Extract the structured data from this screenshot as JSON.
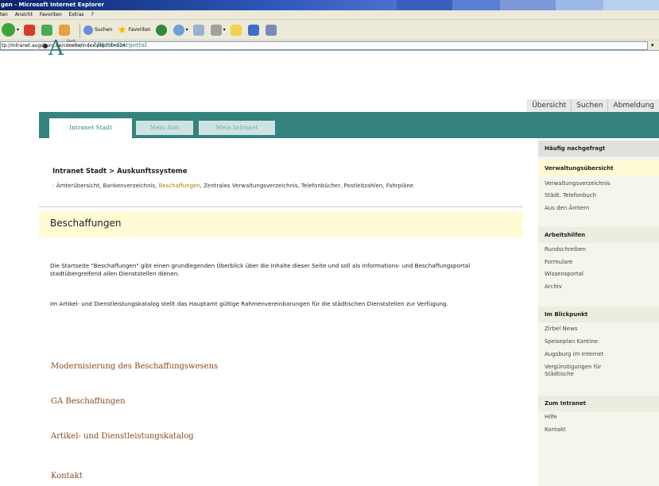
{
  "window": {
    "title": "gen - Microsoft Internet Explorer",
    "menu": [
      "ten",
      "Ansicht",
      "Favoriten",
      "Extras",
      "?"
    ],
    "toolbar": {
      "search_label": "Suchen",
      "favorites_label": "Favoriten"
    },
    "address": "tp://intranet.augsburg.de/cocoite/index.php?id=924"
  },
  "header": {
    "logo_small": "Stadt Augsburg",
    "portal_name": "Mitarbeiterportal",
    "topnav": [
      "Übersicht",
      "Suchen",
      "Abmeldung"
    ]
  },
  "tabs": [
    "Intranet Stadt",
    "Mein Amt",
    "Mein Intranet"
  ],
  "breadcrumb": "Intranet Stadt > Auskunftssysteme",
  "subnav": {
    "before": "Ämterübersicht, Bankenverzeichnis, ",
    "current": "Beschaffungen",
    "after": ", Zentrales Verwaltungsverzeichnis, Telefonbücher, Postleitzahlen, Fahrpläne"
  },
  "main": {
    "title": "Beschaffungen",
    "para1": "Die Startseite \"Beschaffungen\" gibt einen grundlegenden Überblick über die Inhalte dieser Seite und soll als Informations- und Beschaffungsportal stadtübergreifend allen Dienststellen dienen.",
    "para2": "Im Artikel- und Dienstleistungskatalog stellt das Hauptamt gültige Rahmenvereinbarungen für die städtischen Dienststellen zur Verfügung.",
    "links": [
      "Modernisierung des Beschaffungswesens",
      "GA Beschaffungen",
      "Artikel- und Dienstleistungskatalog",
      "Kontakt"
    ]
  },
  "sidebar": {
    "heading": "Häufig nachgefragt",
    "sections": [
      {
        "title": "Verwaltungsübersicht",
        "items": [
          "Verwaltungsverzeichnis",
          "Städt. Telefonbuch",
          "Aus den Ämtern"
        ]
      },
      {
        "title": "Arbeitshilfen",
        "items": [
          "Rundschreiben",
          "Formulare",
          "Wissensportal",
          "Archiv"
        ]
      },
      {
        "title": "Im Blickpunkt",
        "items": [
          "Zirbel News",
          "Speiseplan Kantine",
          "Augsburg im Internet",
          "Vergünstigungen für Städtische"
        ]
      },
      {
        "title": "Zum Intranet",
        "items": [
          "Hilfe",
          "Kontakt"
        ]
      }
    ]
  },
  "colors": {
    "teal": "#34837f",
    "link": "#8a4a1a",
    "highlight": "#fffbd5"
  }
}
